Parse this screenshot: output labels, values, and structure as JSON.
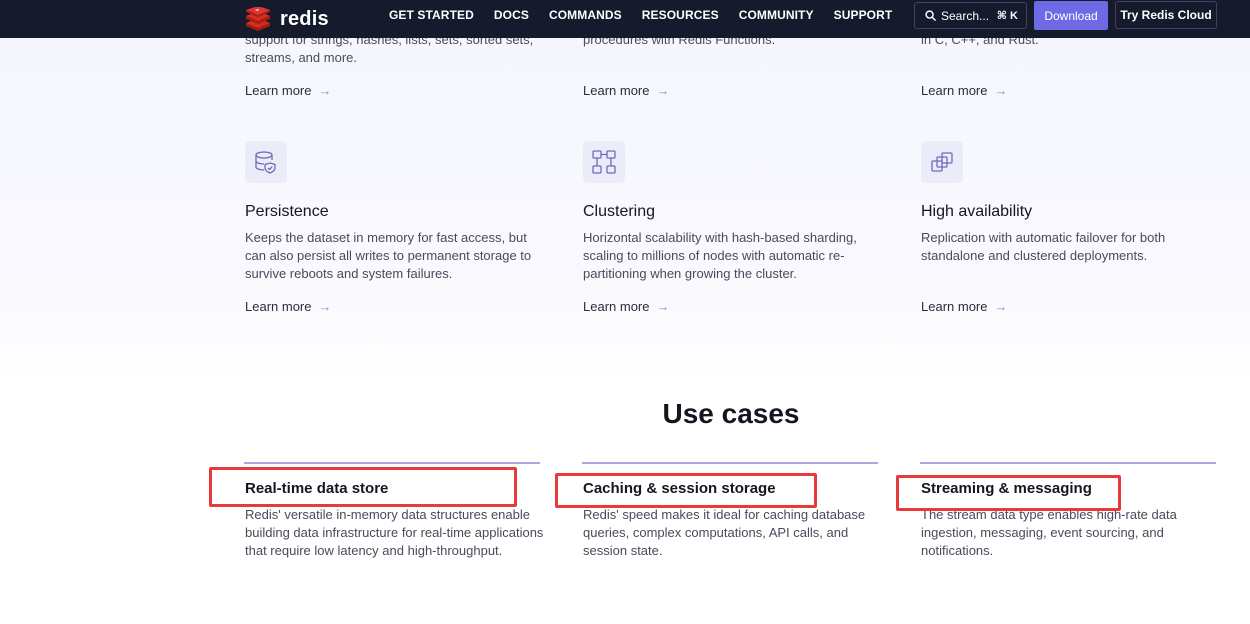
{
  "nav": {
    "brand": "redis",
    "items": [
      "GET STARTED",
      "DOCS",
      "COMMANDS",
      "RESOURCES",
      "COMMUNITY",
      "SUPPORT"
    ],
    "search_label": "Search...",
    "search_shortcut": "⌘ K",
    "download_label": "Download",
    "cloud_label": "Try Redis Cloud"
  },
  "top_partial": [
    {
      "text": "support for strings, hashes, lists, sets, sorted sets, streams, and more.",
      "learn_more": "Learn more"
    },
    {
      "text": "procedures with Redis Functions.",
      "learn_more": "Learn more"
    },
    {
      "text": "in C, C++, and Rust.",
      "learn_more": "Learn more"
    }
  ],
  "features": [
    {
      "icon": "database-shield-icon",
      "title": "Persistence",
      "description": "Keeps the dataset in memory for fast access, but can also persist all writes to permanent storage to survive reboots and system failures.",
      "learn_more": "Learn more"
    },
    {
      "icon": "cluster-grid-icon",
      "title": "Clustering",
      "description": "Horizontal scalability with hash-based sharding, scaling to millions of nodes with automatic re-partitioning when growing the cluster.",
      "learn_more": "Learn more"
    },
    {
      "icon": "replication-copy-icon",
      "title": "High availability",
      "description": "Replication with automatic failover for both standalone and clustered deployments.",
      "learn_more": "Learn more"
    }
  ],
  "use_cases": {
    "title": "Use cases",
    "items": [
      {
        "title": "Real-time data store",
        "description": "Redis' versatile in-memory data structures enable building data infrastructure for real-time applications that require low latency and high-throughput."
      },
      {
        "title": "Caching & session storage",
        "description": "Redis' speed makes it ideal for caching database queries, complex computations, API calls, and session state."
      },
      {
        "title": "Streaming & messaging",
        "description": "The stream data type enables high-rate data ingestion, messaging, event sourcing, and notifications."
      }
    ]
  },
  "colors": {
    "nav_bg": "#151b2c",
    "accent": "#6e6ae6",
    "highlight": "#e83a3a",
    "divider": "#a9a9de"
  }
}
